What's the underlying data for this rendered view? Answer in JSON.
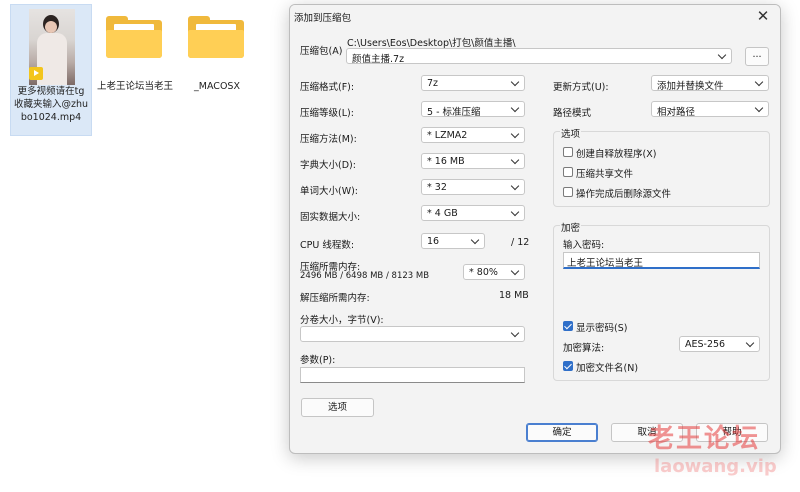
{
  "desktop": {
    "files": [
      {
        "name": "更多视频请在tg收藏夹输入@zhubo1024.mp4",
        "type": "video",
        "badge_icon": "player-icon"
      },
      {
        "name": "上老王论坛当老王",
        "type": "folder"
      },
      {
        "name": "_MACOSX",
        "type": "folder"
      }
    ]
  },
  "dialog": {
    "title": "添加到压缩包",
    "archive": {
      "label": "压缩包(A)",
      "path": "C:\\Users\\Eos\\Desktop\\打包\\颜值主播\\",
      "filename": "颜值主播.7z",
      "browse_label": "..."
    },
    "left": {
      "format": {
        "label": "压缩格式(F):",
        "value": "7z"
      },
      "level": {
        "label": "压缩等级(L):",
        "value": "5 - 标准压缩"
      },
      "method": {
        "label": "压缩方法(M):",
        "value": "* LZMA2"
      },
      "dict": {
        "label": "字典大小(D):",
        "value": "* 16 MB"
      },
      "word": {
        "label": "单词大小(W):",
        "value": "* 32"
      },
      "solid": {
        "label": "固实数据大小:",
        "value": "* 4 GB"
      },
      "threads": {
        "label": "CPU 线程数:",
        "value": "16",
        "max": "/ 12"
      },
      "mem_comp": {
        "label": "压缩所需内存:",
        "detail": "2496 MB / 6498 MB / 8123 MB",
        "value": "* 80%"
      },
      "mem_decomp": {
        "label": "解压缩所需内存:",
        "value": "18 MB"
      },
      "split": {
        "label": "分卷大小，字节(V):",
        "value": ""
      },
      "params": {
        "label": "参数(P):",
        "value": ""
      },
      "options_button": "选项"
    },
    "right": {
      "update": {
        "label": "更新方式(U):",
        "value": "添加并替换文件"
      },
      "path_mode": {
        "label": "路径模式",
        "value": "相对路径"
      },
      "options_group": {
        "title": "选项",
        "items": [
          {
            "label": "创建自释放程序(X)",
            "checked": false
          },
          {
            "label": "压缩共享文件",
            "checked": false
          },
          {
            "label": "操作完成后删除源文件",
            "checked": false
          }
        ]
      },
      "encryption": {
        "title": "加密",
        "password_label": "输入密码:",
        "password_value": "上老王论坛当老王",
        "show_password": {
          "label": "显示密码(S)",
          "checked": true
        },
        "method_label": "加密算法:",
        "method_value": "AES-256",
        "encrypt_names": {
          "label": "加密文件名(N)",
          "checked": true
        }
      }
    },
    "buttons": {
      "ok": "确定",
      "cancel": "取消",
      "help": "帮助"
    }
  },
  "watermark": {
    "main": "老王论坛",
    "sub": "laowang.vip"
  }
}
